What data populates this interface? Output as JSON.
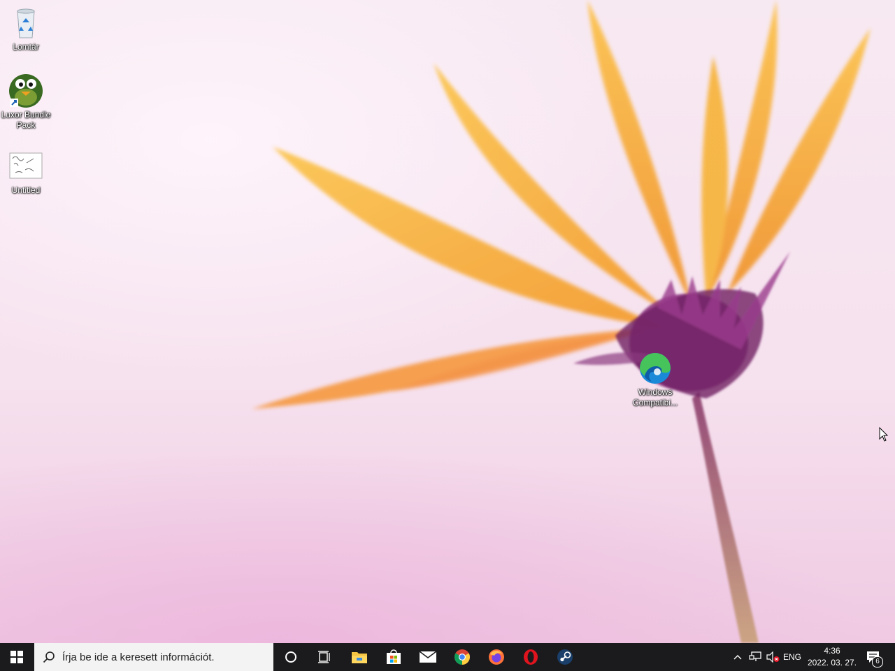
{
  "desktop": {
    "icons": [
      {
        "label": "Lomtár",
        "icon": "recycle-bin-icon"
      },
      {
        "label": "Luxor Bundle Pack",
        "icon": "luxor-frog-icon"
      },
      {
        "label": "Untitled",
        "icon": "paint-image-icon"
      },
      {
        "label": "Windows Compatibi...",
        "icon": "edge-icon"
      }
    ]
  },
  "taskbar": {
    "search_placeholder": "Írja be ide a keresett információt.",
    "pinned": [
      "cortana-icon",
      "task-view-icon",
      "file-explorer-icon",
      "microsoft-store-icon",
      "mail-icon",
      "chrome-icon",
      "firefox-icon",
      "opera-icon",
      "steam-icon"
    ],
    "tray": {
      "language": "ENG",
      "time": "4:36",
      "date": "2022. 03. 27.",
      "notification_count": "6"
    }
  },
  "colors": {
    "taskbar": "#1b1b1d",
    "accent_orange": "#f6a826",
    "flower_purple": "#7a2a6a"
  }
}
